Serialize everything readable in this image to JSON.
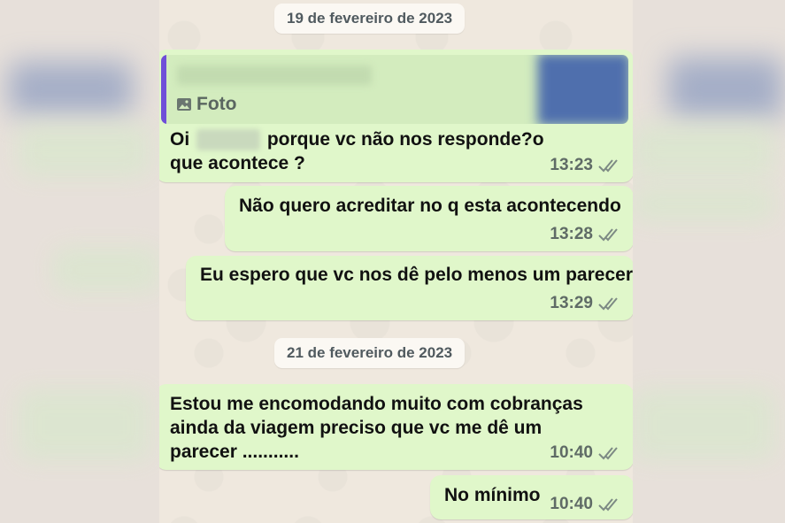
{
  "dates": {
    "first": "19 de fevereiro de 2023",
    "second": "21 de fevereiro de 2023"
  },
  "quote": {
    "label": "Foto",
    "icon": "photo-icon"
  },
  "messages": [
    {
      "text_before": "Oi",
      "text_after": "porque vc não nos responde?o que acontece ?",
      "time": "13:23",
      "status": "read-double-check"
    },
    {
      "text": "Não quero  acreditar no q esta acontecendo",
      "time": "13:28",
      "status": "read-double-check"
    },
    {
      "text": "Eu espero que vc nos dê pelo menos um parecer",
      "time": "13:29",
      "status": "read-double-check"
    },
    {
      "text": "Estou me encomodando muito com cobranças ainda da viagem preciso que vc me dê um parecer ...........",
      "time": "10:40",
      "status": "read-double-check"
    },
    {
      "text": "No mínimo",
      "time": "10:40",
      "status": "read-double-check"
    }
  ],
  "colors": {
    "bubble": "#e0f7ca",
    "quote_bar": "#6f4fd8",
    "chat_background": "#efe8de"
  }
}
